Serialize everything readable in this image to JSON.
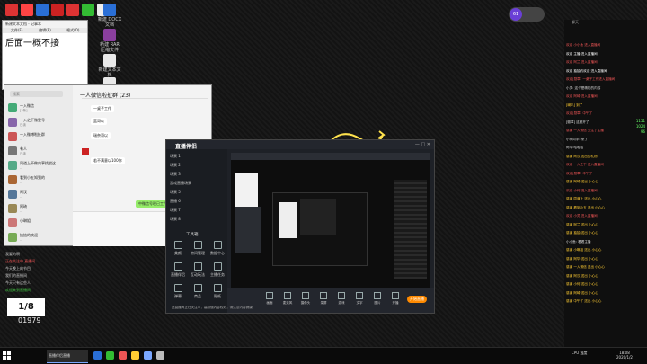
{
  "desktop_icons": [
    {
      "icon": "app-icon-1",
      "color": "#d33"
    },
    {
      "icon": "app-icon-2",
      "color": "#f44"
    },
    {
      "icon": "app-icon-3",
      "color": "#2a6fd6"
    },
    {
      "icon": "app-icon-4",
      "color": "#c22"
    },
    {
      "icon": "app-icon-5",
      "color": "#d33"
    },
    {
      "icon": "app-icon-6",
      "color": "#3b3"
    },
    {
      "icon": "app-icon-7",
      "color": "#eee"
    }
  ],
  "desktop_files": [
    {
      "label": "新建 DOCX 文档"
    },
    {
      "label": "新建 RAR 压缩文件"
    },
    {
      "label": "新建文本文档"
    },
    {
      "label": "新建文本文档"
    }
  ],
  "viewer_badge": {
    "count": "61",
    "color": "#6a3fd6"
  },
  "notepad": {
    "title": "新建文本文档 - 记事本",
    "tabs": [
      "文件(F)",
      "编辑(E)",
      "格式(O)"
    ],
    "content": "后面一概不接"
  },
  "wechat": {
    "search": "搜索",
    "chat_title": "一人微信啦扯群 (23)",
    "conversations": [
      {
        "name": "一入微信",
        "msg": "[3条]...",
        "color": "#4a7"
      },
      {
        "name": "一入之下微登号",
        "msg": "已读",
        "color": "#86a"
      },
      {
        "name": "一入微博啦扯群",
        "msg": "...",
        "color": "#c55"
      },
      {
        "name": "有人",
        "msg": "已读",
        "color": "#777"
      },
      {
        "name": "同道上不做内事找战这",
        "msg": "...",
        "color": "#5a8"
      },
      {
        "name": "看到小五知到的",
        "msg": "...",
        "color": "#a63"
      },
      {
        "name": "阿汉",
        "msg": "...",
        "color": "#579"
      },
      {
        "name": "阿琦",
        "msg": "...",
        "color": "#985"
      },
      {
        "name": "小琳姐",
        "msg": "...",
        "color": "#c77"
      },
      {
        "name": "抽抽的欢迎",
        "msg": "...",
        "color": "#7a5"
      }
    ],
    "messages": [
      {
        "text": "一桌子工作"
      },
      {
        "text": "蓝哥以"
      },
      {
        "text": "瑞奈哥以"
      },
      {
        "text": "若不满意以100你"
      },
      {
        "text": "中微信号现已工作中"
      }
    ]
  },
  "obs": {
    "app_name": "直播伴侣",
    "scenes": [
      "场景 1",
      "场景 2",
      "场景 3",
      "游戏直播场景",
      "场景 5",
      "直播 6",
      "场景 7",
      "场景 8"
    ],
    "tools_header": "工具箱",
    "tools": [
      {
        "label": "美颜",
        "icon": "beauty-icon"
      },
      {
        "label": "房间管理",
        "icon": "room-icon"
      },
      {
        "label": "数据中心",
        "icon": "data-icon"
      },
      {
        "label": "直播伴侣",
        "icon": "companion-icon"
      },
      {
        "label": "互动玩法",
        "icon": "interact-icon"
      },
      {
        "label": "主播任务",
        "icon": "task-icon"
      },
      {
        "label": "弹幕",
        "icon": "danmu-icon"
      },
      {
        "label": "商品",
        "icon": "goods-icon"
      },
      {
        "label": "贴纸",
        "icon": "sticker-icon"
      }
    ],
    "bottom_buttons": [
      "画面",
      "麦克风",
      "摄像头",
      "录屏",
      "游戏",
      "文字",
      "图片",
      "开播"
    ],
    "start_live": "开始直播",
    "status": "此直播间正在关注中，高颜值内容较好，请注意内容健康"
  },
  "left_chat": {
    "viewer_count": "01979",
    "lines": [
      {
        "text": "我要的啊",
        "color": "#ccc"
      },
      {
        "text": "正在关注中 直播间",
        "color": "#e55"
      },
      {
        "text": "今天晚上的节目",
        "color": "#ccc"
      },
      {
        "text": "我们的直播间",
        "color": "#ccc"
      },
      {
        "text": "今天只有这些人",
        "color": "#ccc"
      },
      {
        "text": "欢迎来到直播间",
        "color": "#4c4"
      }
    ]
  },
  "right_chat": {
    "header": "聊天",
    "lines": [
      {
        "text": "欢迎 小小鱼 进入直播间",
        "color": "#e55"
      },
      {
        "text": "欢迎 主播 进入直播间",
        "color": "#fff"
      },
      {
        "text": "欢迎 阿兰 进入直播间",
        "color": "#e55"
      },
      {
        "text": "欢迎 抽抽的欢迎 进入直播间",
        "color": "#fff"
      },
      {
        "text": "欢迎[勋章] 一桌子工作进入直播间",
        "color": "#e55"
      },
      {
        "text": "小灵: 这个是精彩的内容",
        "color": "#ddd"
      },
      {
        "text": "欢迎 阿琦 进入直播间",
        "color": "#e55"
      },
      {
        "text": "[喇叭] 到了",
        "color": "#fc3"
      },
      {
        "text": "欢迎[勋章] 中午了",
        "color": "#e55"
      },
      {
        "text": "[徽章] 这都开了",
        "color": "#ddd"
      },
      {
        "text": "感谢 一入微信 关注了主播",
        "color": "#e55"
      },
      {
        "text": "小何同学: 来了",
        "color": "#ddd"
      },
      {
        "text": "阿华:哈哈哈",
        "color": "#ddd"
      },
      {
        "text": "感谢 阿汉 送出的礼物",
        "color": "#fc3"
      },
      {
        "text": "欢迎 一入之下 进入直播间",
        "color": "#e55"
      },
      {
        "text": "欢迎[勋章] 中午了",
        "color": "#e55"
      },
      {
        "text": "感谢 阿琦 送出 小心心",
        "color": "#fc3"
      },
      {
        "text": "欢迎 小何 进入直播间",
        "color": "#e55"
      },
      {
        "text": "感谢 同道上 送出 小心心",
        "color": "#fc3"
      },
      {
        "text": "感谢 看到小五 送出 小心心",
        "color": "#fc3"
      },
      {
        "text": "欢迎 小灵 进入直播间",
        "color": "#e55"
      },
      {
        "text": "感谢 阿兰 送出 小心心",
        "color": "#fc3"
      },
      {
        "text": "感谢 抽抽 送出 小心心",
        "color": "#fc3"
      },
      {
        "text": "小小鱼: 看看主播",
        "color": "#ddd"
      },
      {
        "text": "感谢 小琳姐 送出 小心心",
        "color": "#fc3"
      },
      {
        "text": "感谢 阿华 送出 小心心",
        "color": "#fc3"
      },
      {
        "text": "感谢 一入微信 送出 小心心",
        "color": "#fc3"
      },
      {
        "text": "感谢 阿汉 送出 小心心",
        "color": "#fc3"
      },
      {
        "text": "感谢 小何 送出 小心心",
        "color": "#fc3"
      },
      {
        "text": "感谢 阿琦 送出 小心心",
        "color": "#fc3"
      },
      {
        "text": "感谢 中午了 送出 小心心",
        "color": "#fc3"
      }
    ],
    "side_numbers": [
      "1151",
      "1024",
      "96"
    ]
  },
  "taskbar": {
    "time": "18:08",
    "date": "2020/1/2",
    "tray_text": "CPU 温度",
    "tasks": [
      "直播伴侣直播",
      "微信",
      "记事本"
    ]
  }
}
